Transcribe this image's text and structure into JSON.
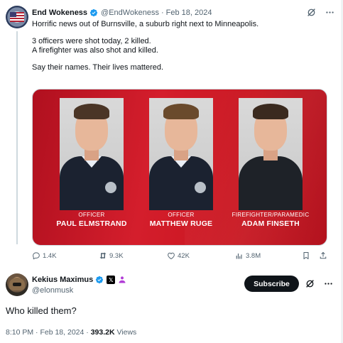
{
  "post": {
    "author_name": "End Wokeness",
    "author_handle": "@EndWokeness",
    "separator": "·",
    "date": "Feb 18, 2024",
    "lines": [
      "Horrific news out of Burnsville, a suburb right next to Minneapolis.",
      "",
      "3 officers were shot today, 2 killed.",
      "A firefighter was also shot and killed.",
      "",
      "Say their names. Their lives mattered."
    ],
    "media": {
      "people": [
        {
          "role": "OFFICER",
          "name": "PAUL ELMSTRAND",
          "hair": "#4a3526"
        },
        {
          "role": "OFFICER",
          "name": "MATTHEW RUGE",
          "hair": "#6a4a2c"
        },
        {
          "role": "FIREFIGHTER/PARAMEDIC",
          "name": "ADAM FINSETH",
          "hair": "#3a2a1f"
        }
      ]
    },
    "stats": {
      "replies": "1.4K",
      "reposts": "9.3K",
      "likes": "42K",
      "views": "3.8M"
    }
  },
  "reply": {
    "author_name": "Kekius Maximus",
    "author_handle": "@elonmusk",
    "x_badge": "𝕏",
    "subscribe_label": "Subscribe",
    "text": "Who killed them?",
    "time": "8:10 PM",
    "separator": "·",
    "date": "Feb 18, 2024",
    "views_count": "393.2K",
    "views_label": "Views"
  },
  "colors": {
    "verified": "#1d9bf0",
    "banner_red": "#d41e2c",
    "affiliate_purple": "#b13cd6"
  }
}
